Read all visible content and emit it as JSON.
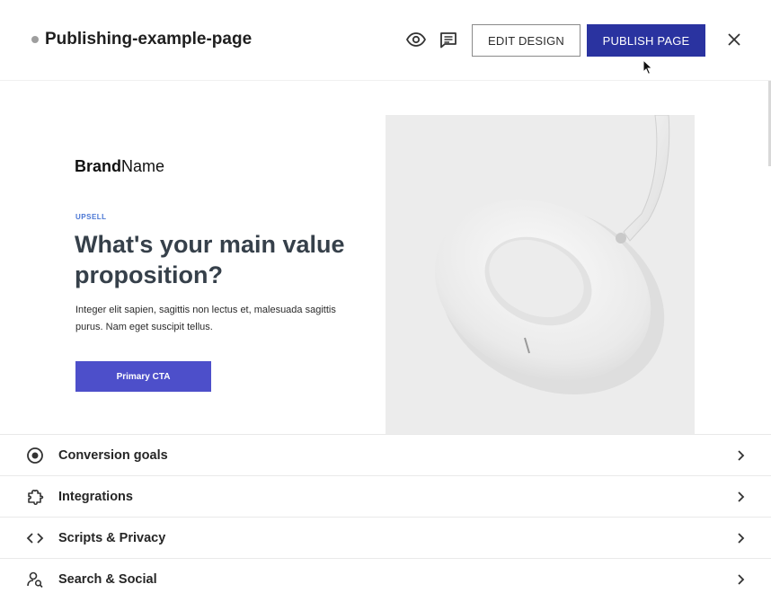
{
  "header": {
    "title": "Publishing-example-page",
    "edit_label": "EDIT DESIGN",
    "publish_label": "PUBLISH PAGE",
    "icons": [
      "dot-status",
      "eye-icon",
      "comment-icon",
      "close-icon"
    ],
    "colors": {
      "publish": "#2a33a0"
    }
  },
  "preview": {
    "brand_bold": "Brand",
    "brand_light": "Name",
    "eyebrow": "UPSELL",
    "headline": "What's your main value proposition?",
    "body": "Integer elit sapien, sagittis non lectus et, malesuada sagittis purus. Nam eget suscipit tellus.",
    "cta": "Primary CTA",
    "image": "white-headphones-photo",
    "colors": {
      "cta": "#4d4fca",
      "eyebrow": "#4a76d4"
    }
  },
  "settings": {
    "items": [
      {
        "label": "Conversion goals",
        "icon": "target-icon"
      },
      {
        "label": "Integrations",
        "icon": "puzzle-icon"
      },
      {
        "label": "Scripts & Privacy",
        "icon": "code-icon"
      },
      {
        "label": "Search & Social",
        "icon": "user-search-icon"
      }
    ]
  }
}
